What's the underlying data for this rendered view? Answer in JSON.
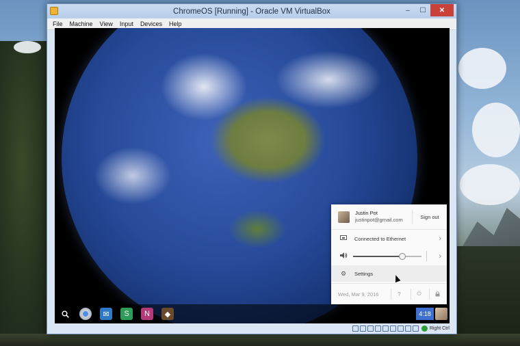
{
  "window": {
    "title": "ChromeOS [Running] - Oracle VM VirtualBox",
    "minimize_glyph": "–",
    "maximize_glyph": "☐",
    "close_glyph": "✕"
  },
  "menubar": {
    "items": [
      "File",
      "Machine",
      "View",
      "Input",
      "Devices",
      "Help"
    ]
  },
  "shelf": {
    "apps": [
      "search-icon",
      "chrome-icon",
      "mail-icon",
      "sway-icon",
      "onenote-icon",
      "app-icon"
    ],
    "clock": "4:18"
  },
  "tray": {
    "user": {
      "name": "Justin Pot",
      "email": "justinpot@gmail.com",
      "sign_out": "Sign out"
    },
    "network": {
      "label": "Connected to Ethernet"
    },
    "volume": {
      "level": 0.72
    },
    "settings": {
      "label": "Settings"
    },
    "footer": {
      "date": "Wed, Mar 9, 2016",
      "help": "?",
      "power": "⏻",
      "lock": "🔒"
    }
  },
  "statusbar": {
    "host_key": "Right Ctrl"
  },
  "colors": {
    "shelf_clock": "#3f6fcf",
    "close_button": "#c9423a"
  }
}
